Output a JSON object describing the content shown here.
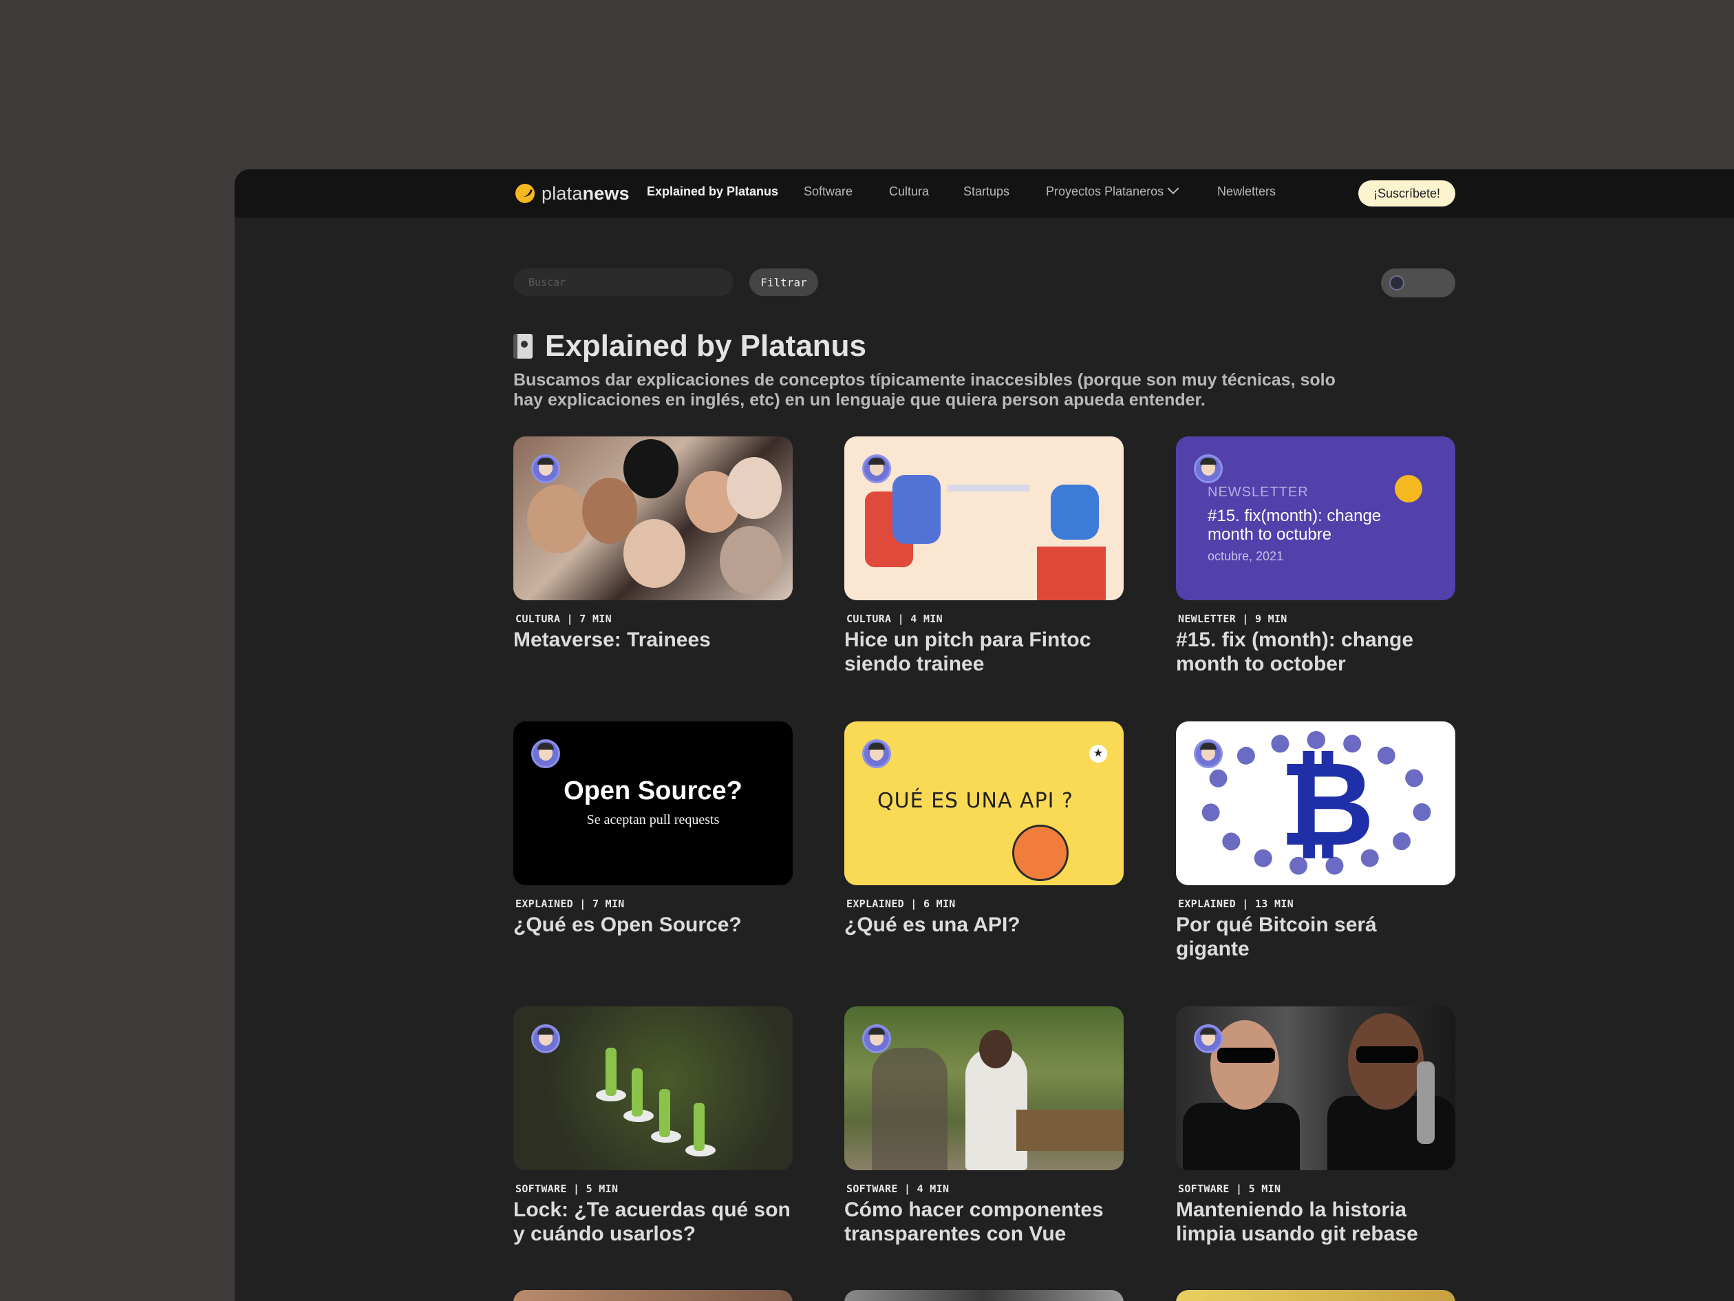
{
  "nav": {
    "logo_light": "plata",
    "logo_bold": "news",
    "items": [
      {
        "label": "Explained by Platanus",
        "active": true
      },
      {
        "label": "Software",
        "active": false
      },
      {
        "label": "Cultura",
        "active": false
      },
      {
        "label": "Startups",
        "active": false
      },
      {
        "label": "Proyectos Plataneros",
        "active": false,
        "dropdown": true
      },
      {
        "label": "Newletters",
        "active": false
      }
    ],
    "subscribe_label": "¡Suscríbete!"
  },
  "toolbar": {
    "search_placeholder": "Buscar",
    "filter_label": "Filtrar",
    "theme_toggle_icon": "moon-icon"
  },
  "header": {
    "title": "Explained by Platanus",
    "title_icon": "notebook-icon",
    "description": "Buscamos dar explicaciones de conceptos típicamente inaccesibles (porque son muy técnicas, solo hay explicaciones en inglés, etc) en un lenguaje que quiera person apueda entender."
  },
  "posts": [
    {
      "meta": "CULTURA | 7 MIN",
      "title": "Metaverse: Trainees"
    },
    {
      "meta": "CULTURA | 4 MIN",
      "title": "Hice un pitch para Fintoc siendo trainee"
    },
    {
      "meta": "NEWLETTER | 9 MIN",
      "title": "#15. fix (month): change month to october",
      "thumb": {
        "label": "NEWSLETTER",
        "title": "#15. fix(month): change month to octubre",
        "date": "octubre, 2021"
      }
    },
    {
      "meta": "EXPLAINED | 7 MIN",
      "title": "¿Qué es Open Source?",
      "thumb": {
        "title": "Open Source?",
        "subtitle": "Se aceptan pull requests"
      }
    },
    {
      "meta": "EXPLAINED | 6 MIN",
      "title": "¿Qué es una API?",
      "thumb": {
        "title": "QUÉ ES UNA API ?"
      }
    },
    {
      "meta": "EXPLAINED | 13 MIN",
      "title": "Por qué Bitcoin será gigante",
      "thumb": {
        "symbol": "₿"
      }
    },
    {
      "meta": "SOFTWARE | 5 MIN",
      "title": "Lock: ¿Te acuerdas qué son y cuándo usarlos?"
    },
    {
      "meta": "SOFTWARE | 4 MIN",
      "title": "Cómo hacer componentes transparentes con Vue"
    },
    {
      "meta": "SOFTWARE | 5 MIN",
      "title": "Manteniendo la historia limpia usando git rebase"
    }
  ],
  "colors": {
    "background": "#3d3a39",
    "window": "#212121",
    "topbar": "#131313",
    "accent": "#f5b820",
    "subscribe_bg": "#fcf3cf",
    "newsletter_bg": "#5241ab",
    "api_bg": "#fad955"
  }
}
